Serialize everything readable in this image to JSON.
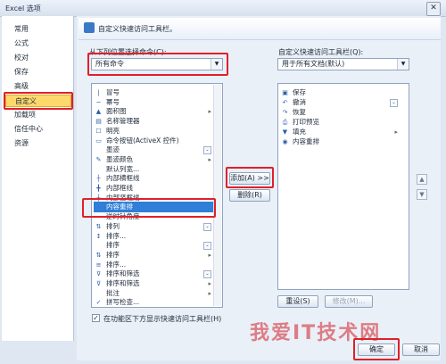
{
  "window": {
    "title": "Excel 选项"
  },
  "sidebar": {
    "items": [
      "常用",
      "公式",
      "校对",
      "保存",
      "高级",
      "自定义",
      "加载项",
      "信任中心",
      "资源"
    ],
    "selected_index": 5
  },
  "header": {
    "title": "自定义快速访问工具栏。"
  },
  "left": {
    "label": "从下列位置选择命令(C):",
    "dropdown_value": "所有命令",
    "items": [
      {
        "icon": "bar-icon",
        "label": "冒号"
      },
      {
        "icon": "tilde-icon",
        "label": "幂号"
      },
      {
        "icon": "chart-icon",
        "label": "面积图",
        "sub": "▸"
      },
      {
        "icon": "name-manager-icon",
        "label": "名称管理器"
      },
      {
        "icon": "shade-icon",
        "label": "明亮"
      },
      {
        "icon": "activex-icon",
        "label": "命令按钮(ActiveX 控件)"
      },
      {
        "icon": "",
        "label": "墨迹",
        "drop": "⌄"
      },
      {
        "icon": "pen-icon",
        "label": "墨迹颜色",
        "sub": "▸"
      },
      {
        "icon": "",
        "label": "默认列宽..."
      },
      {
        "icon": "border-inner-h-icon",
        "label": "内部横框线"
      },
      {
        "icon": "border-inner-icon",
        "label": "内部框线"
      },
      {
        "icon": "border-inner-v-icon",
        "label": "内部竖框线"
      },
      {
        "icon": "",
        "label": "内容重排",
        "selected": true
      },
      {
        "icon": "",
        "label": "逆时针角度"
      },
      {
        "icon": "sort-icon",
        "label": "排列",
        "drop": "⌄"
      },
      {
        "icon": "sort-az-icon",
        "label": "排序..."
      },
      {
        "icon": "",
        "label": "排序",
        "drop": "⌄"
      },
      {
        "icon": "sort-icon",
        "label": "排序",
        "sub": "▸"
      },
      {
        "icon": "sort-list-icon",
        "label": "排序..."
      },
      {
        "icon": "filter-icon",
        "label": "排序和筛选",
        "drop": "⌄"
      },
      {
        "icon": "filter-icon",
        "label": "排序和筛选",
        "sub": "▸"
      },
      {
        "icon": "",
        "label": "批注",
        "sub": "▸"
      },
      {
        "icon": "spell-icon",
        "label": "拼写检查..."
      }
    ]
  },
  "right": {
    "label": "自定义快速访问工具栏(Q):",
    "dropdown_value": "用于所有文档(默认)",
    "items": [
      {
        "icon": "save-icon",
        "label": "保存"
      },
      {
        "icon": "undo-icon",
        "label": "撤消",
        "drop": "⌄"
      },
      {
        "icon": "redo-icon",
        "label": "恢复"
      },
      {
        "icon": "print-preview-icon",
        "label": "打印预览"
      },
      {
        "icon": "fill-icon",
        "label": "填充",
        "sub": "▸"
      },
      {
        "icon": "reflow-icon",
        "label": "内容重排"
      }
    ]
  },
  "buttons": {
    "add": "添加(A) >>",
    "remove": "删除(R)",
    "reset": "重设(S)",
    "modify": "修改(M)...",
    "ok": "确定",
    "cancel": "取消"
  },
  "checkbox": {
    "label": "在功能区下方显示快速访问工具栏(H)",
    "checked": true
  },
  "watermark": "我爱IT技术网"
}
